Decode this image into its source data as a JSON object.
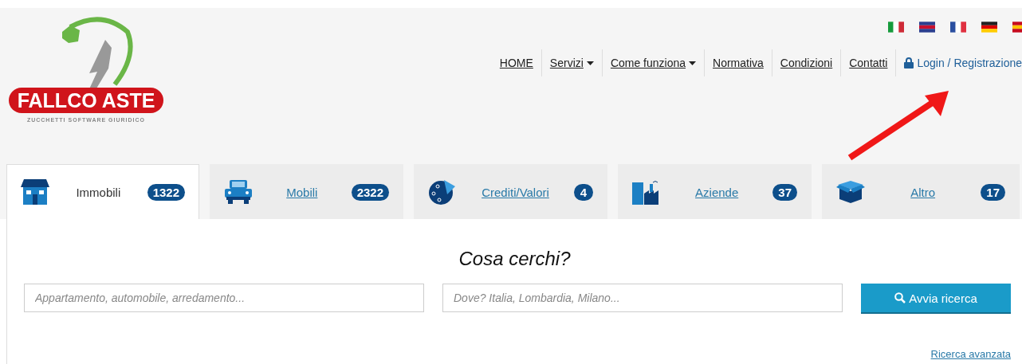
{
  "logo": {
    "name": "FALLCO ASTE",
    "tagline": "ZUCCHETTI SOFTWARE GIURIDICO"
  },
  "nav": [
    {
      "label": "HOME",
      "kind": "link"
    },
    {
      "label": "Servizi",
      "kind": "dropdown"
    },
    {
      "label": "Come funziona",
      "kind": "dropdown"
    },
    {
      "label": "Normativa",
      "kind": "link"
    },
    {
      "label": "Condizioni",
      "kind": "link"
    },
    {
      "label": "Contatti",
      "kind": "link"
    },
    {
      "label": "Login / Registrazione",
      "kind": "login"
    }
  ],
  "tabs": [
    {
      "label": "Immobili",
      "count": "1322",
      "kind": "house",
      "selected": true
    },
    {
      "label": "Mobili",
      "count": "2322",
      "kind": "vehicle",
      "selected": false
    },
    {
      "label": "Crediti/Valori",
      "count": "4",
      "kind": "coins",
      "selected": false
    },
    {
      "label": "Aziende",
      "count": "37",
      "kind": "factory",
      "selected": false
    },
    {
      "label": "Altro",
      "count": "17",
      "kind": "box",
      "selected": false
    }
  ],
  "search": {
    "title": "Cosa cerchi?",
    "what_placeholder": "Appartamento, automobile, arredamento...",
    "where_placeholder": "Dove? Italia, Lombardia, Milano...",
    "button": "Avvia ricerca",
    "advanced_link": "Ricerca avanzata"
  }
}
